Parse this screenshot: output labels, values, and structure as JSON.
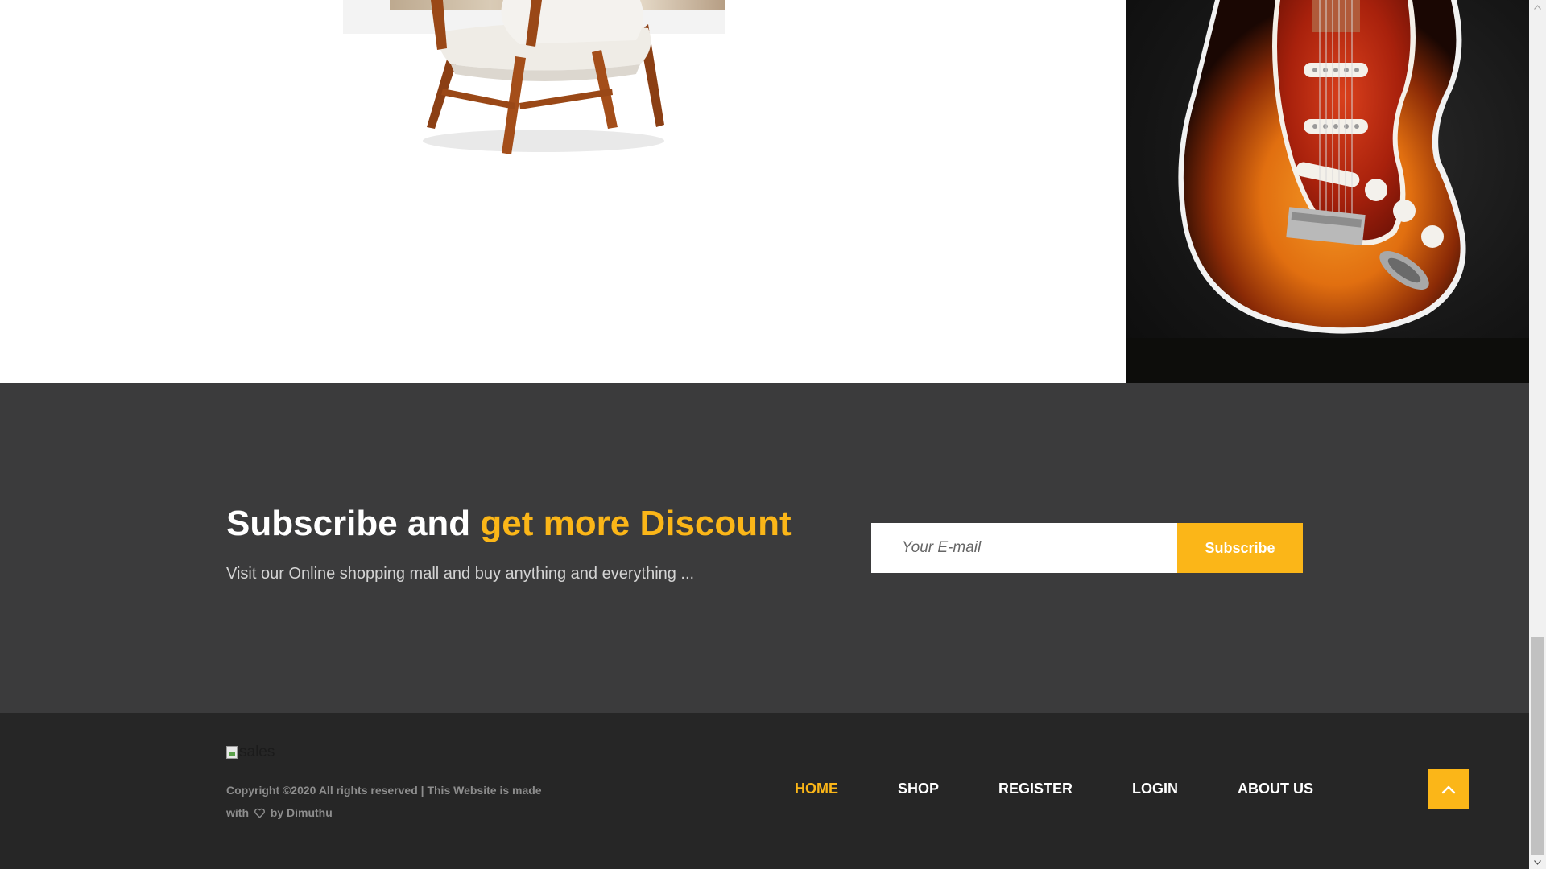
{
  "products": {
    "chair_image_alt": "chair",
    "guitar_image_alt": "guitar"
  },
  "subscribe": {
    "heading_plain": "Subscribe and ",
    "heading_accent": "get more Discount",
    "subtitle": "Visit our Online shopping mall and buy anything and everything ...",
    "email_placeholder": "Your E-mail",
    "button_label": "Subscribe"
  },
  "footer": {
    "logo_alt": "sales",
    "copyright_prefix": "Copyright ©2020 All rights reserved | This Website is made with",
    "copyright_suffix": "by Dimuthu",
    "nav": {
      "home": "HOME",
      "shop": "SHOP",
      "register": "REGISTER",
      "login": "LOGIN",
      "about": "ABOUT US"
    },
    "heart_icon": "heart-icon",
    "back_to_top_icon": "chevron-up-icon"
  },
  "colors": {
    "accent": "#fbb618",
    "subscribe_bg": "#3b3b3c",
    "footer_bg": "#262626"
  }
}
